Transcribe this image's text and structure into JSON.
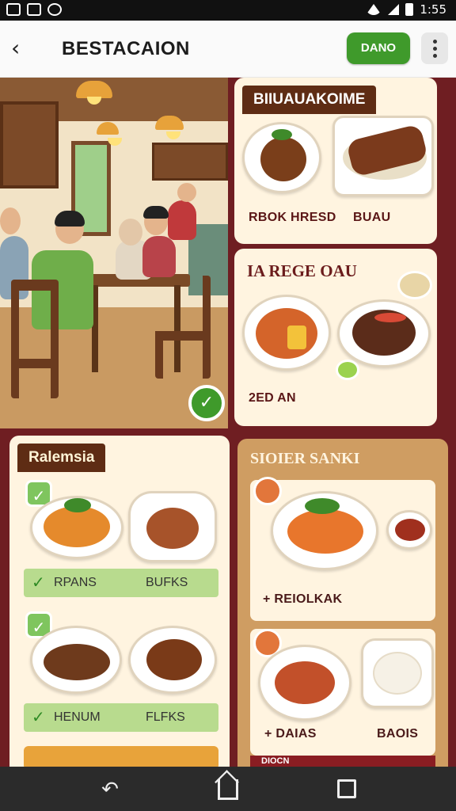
{
  "status_bar": {
    "time": "1:55"
  },
  "app_bar": {
    "title": "BESTACAION",
    "menu_button": "DANO"
  },
  "cards": {
    "top_right": {
      "title": "BIIUAUAKOIME",
      "left_label": "RBOK HRESD",
      "right_label": "BUAU"
    },
    "middle_right": {
      "title": "IA REGE OAU",
      "label": "2ED AN"
    },
    "bottom_left": {
      "title": "Ralemsia",
      "row1": {
        "left": "RPANS",
        "right": "BUFKS"
      },
      "row2": {
        "left": "HENUM",
        "right": "FLFKS"
      }
    },
    "bottom_right": {
      "title": "SIOIER SANKI",
      "label1": "+ REIOLKAK",
      "label2_left": "+ DAIAS",
      "label2_right": "BAOIS",
      "footer": "DIOCN"
    }
  },
  "colors": {
    "accent_green": "#3f9a2b",
    "frame": "#6f1e22",
    "card_bg": "#fff4e0",
    "title_bg": "#5e2c14"
  },
  "icons": [
    "back-arrow-icon",
    "more-vert-icon",
    "check-icon",
    "nav-back-icon",
    "nav-home-icon",
    "nav-recent-icon"
  ]
}
